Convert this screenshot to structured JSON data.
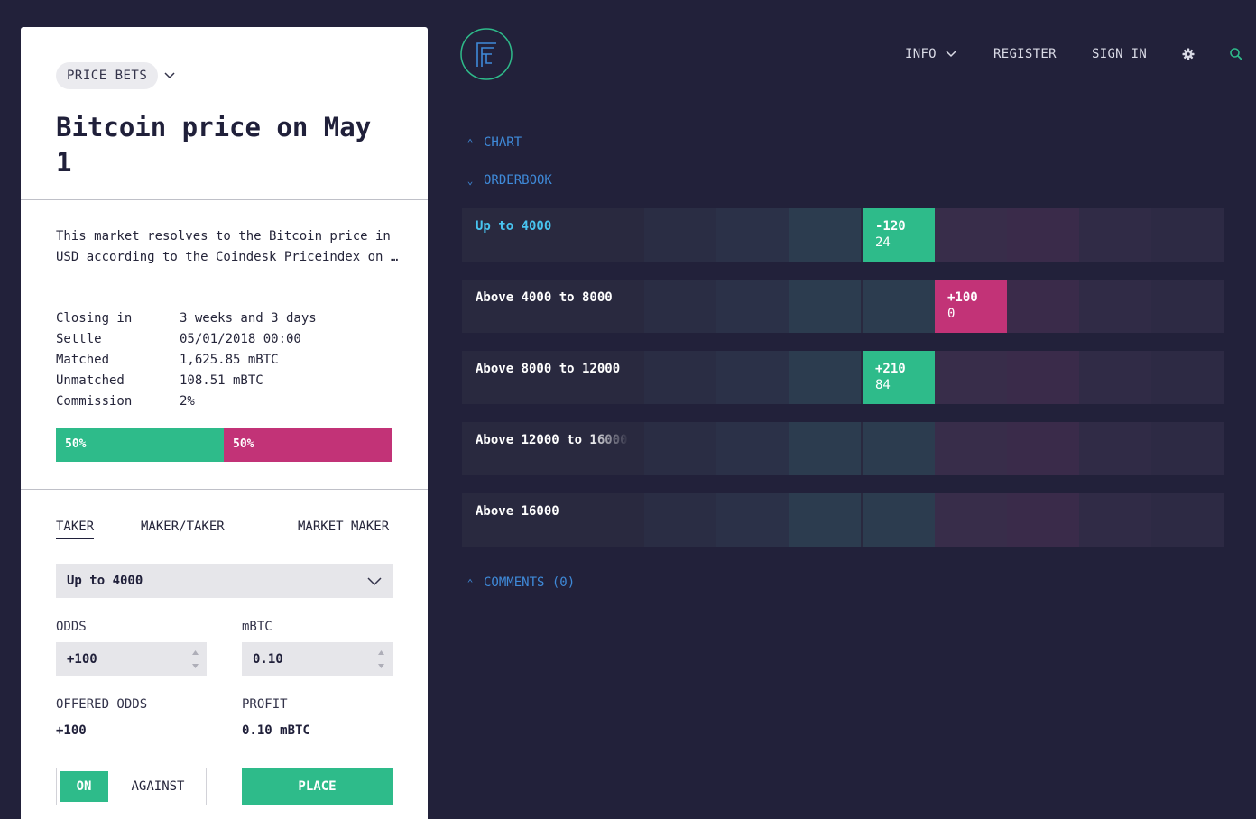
{
  "market": {
    "category": "PRICE BETS",
    "title": "Bitcoin price on May 1",
    "description": "This market resolves to the Bitcoin price in USD according to the Coindesk Priceindex on …",
    "stats": [
      {
        "label": "Closing in",
        "value": "3 weeks and 3 days"
      },
      {
        "label": "Settle",
        "value": "05/01/2018 00:00"
      },
      {
        "label": "Matched",
        "value": "1,625.85 mBTC"
      },
      {
        "label": "Unmatched",
        "value": "108.51 mBTC"
      },
      {
        "label": "Commission",
        "value": "2%"
      }
    ],
    "split": {
      "on": "50%",
      "against": "50%",
      "on_fraction": 0.5
    }
  },
  "bet": {
    "tabs": [
      "TAKER",
      "MAKER/TAKER",
      "MARKET MAKER"
    ],
    "active_tab": "TAKER",
    "outcome": "Up to 4000",
    "odds_label": "ODDS",
    "odds_value": "+100",
    "amount_label": "mBTC",
    "amount_value": "0.10",
    "offered_odds_label": "OFFERED ODDS",
    "offered_odds_value": "+100",
    "profit_label": "PROFIT",
    "profit_value": "0.10 mBTC",
    "toggle_on": "ON",
    "toggle_against": "AGAINST",
    "place": "PLACE"
  },
  "nav": {
    "info": "INFO",
    "register": "REGISTER",
    "sign_in": "SIGN IN"
  },
  "sections": {
    "chart": "CHART",
    "orderbook": "ORDERBOOK",
    "comments": "COMMENTS (0)"
  },
  "orderbook": [
    {
      "label": "Up to 4000",
      "active": true,
      "bet": {
        "odds": "-120",
        "amount": "24",
        "side": "for",
        "column": 5
      }
    },
    {
      "label": "Above 4000 to 8000",
      "active": false,
      "bet": {
        "odds": "+100",
        "amount": "0",
        "side": "against",
        "column": 6
      }
    },
    {
      "label": "Above 8000 to 12000",
      "active": false,
      "bet": {
        "odds": "+210",
        "amount": "84",
        "side": "for",
        "column": 5
      }
    },
    {
      "label": "Above 12000 to 16000",
      "active": false,
      "bet": null
    },
    {
      "label": "Above 16000",
      "active": false,
      "bet": null
    }
  ],
  "colors": {
    "background": "#22213a",
    "for_green": "#2ebb8a",
    "against_pink": "#c23377",
    "link_blue": "#3f8ad9",
    "active_cyan": "#48c4f0"
  }
}
